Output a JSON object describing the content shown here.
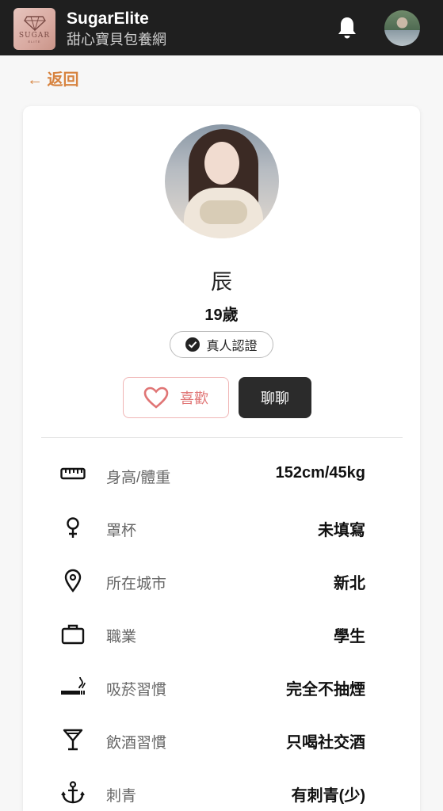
{
  "header": {
    "logo_text": "SUGAR",
    "logo_subtext": "ELITE",
    "title": "SugarElite",
    "subtitle": "甜心寶貝包養網",
    "bell_icon": "bell-icon"
  },
  "back": {
    "label": "← 返回"
  },
  "profile": {
    "name": "辰",
    "age": "19歲",
    "verified_label": "真人認證",
    "like_label": "喜歡",
    "chat_label": "聊聊"
  },
  "details": [
    {
      "icon": "ruler-icon",
      "label": "身高/體重",
      "value": "152cm/45kg"
    },
    {
      "icon": "female-icon",
      "label": "罩杯",
      "value": "未填寫"
    },
    {
      "icon": "location-pin-icon",
      "label": "所在城市",
      "value": "新北"
    },
    {
      "icon": "briefcase-icon",
      "label": "職業",
      "value": "學生"
    },
    {
      "icon": "smoking-icon",
      "label": "吸菸習慣",
      "value": "完全不抽煙"
    },
    {
      "icon": "cocktail-icon",
      "label": "飲酒習慣",
      "value": "只喝社交酒"
    },
    {
      "icon": "anchor-icon",
      "label": "刺青",
      "value": "有刺青(少)"
    }
  ],
  "colors": {
    "accent": "#d7833f",
    "topbar": "#1f1f1f",
    "like": "#e07575",
    "chat": "#2b2b2b"
  }
}
